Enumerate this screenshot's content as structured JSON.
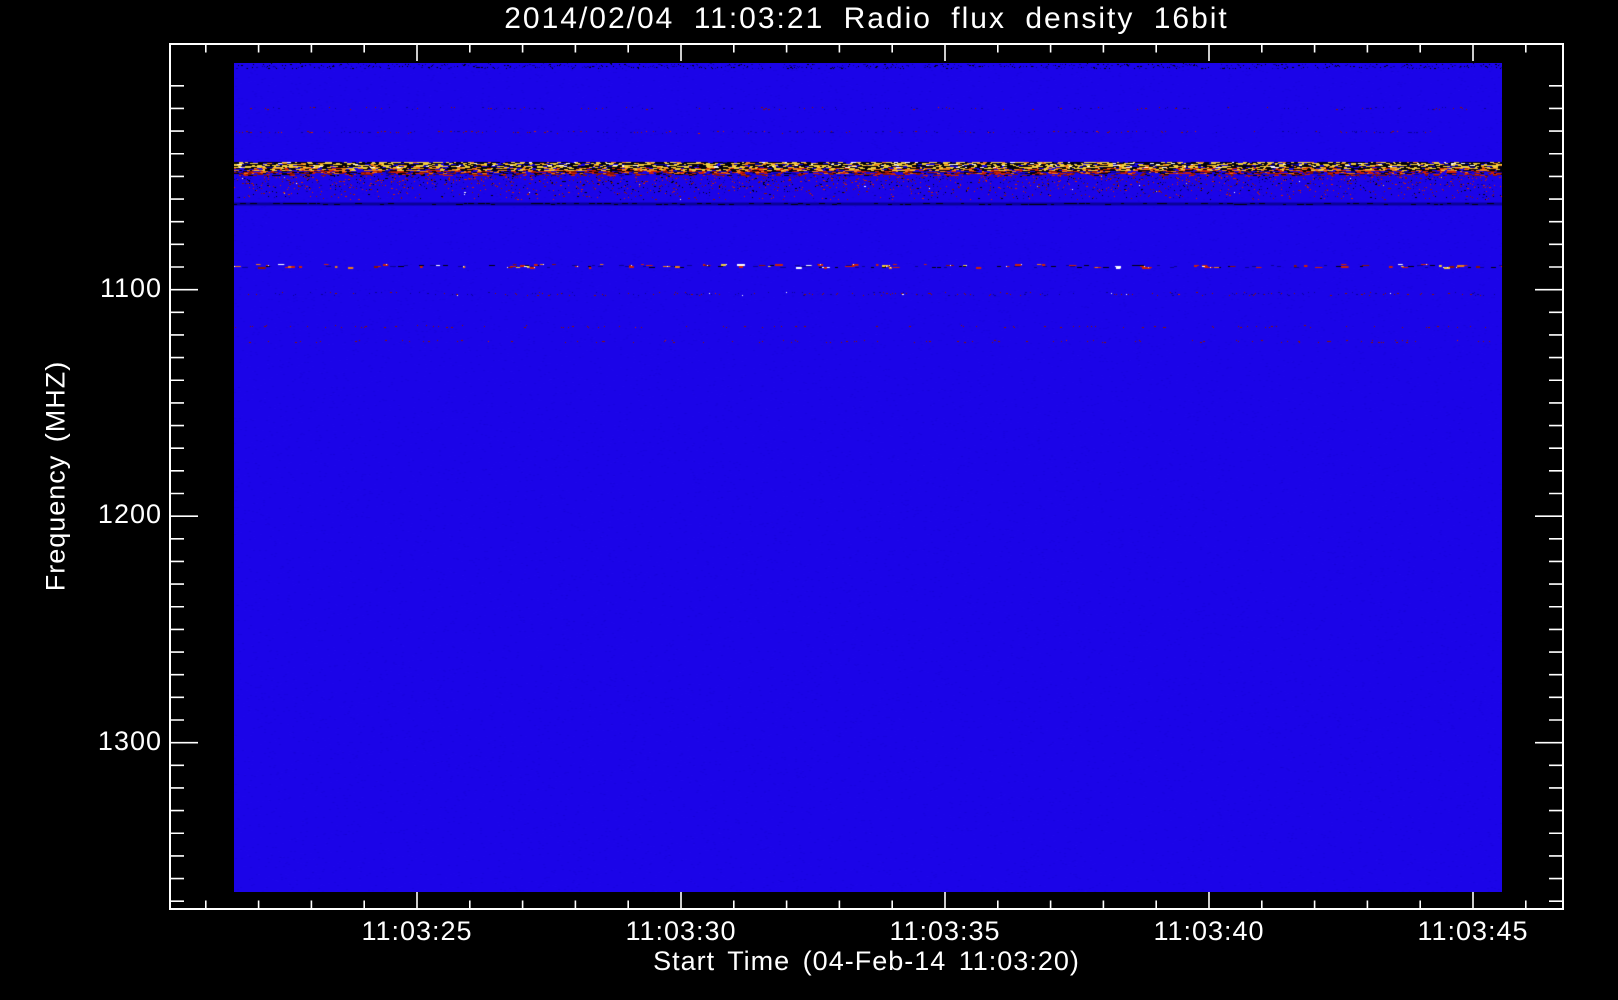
{
  "colors": {
    "page_background": "#000000",
    "frame": "#ffffff",
    "text": "#ffffff"
  },
  "chart_data": {
    "type": "heatmap",
    "title": "2014/02/04 11:03:21 Radio flux density 16bit",
    "x_axis": {
      "label": "Start Time (04-Feb-14 11:03:20)",
      "tick_labels": [
        "11:03:25",
        "11:03:30",
        "11:03:35",
        "11:03:40",
        "11:03:45"
      ],
      "minor_tick_interval_s": 1,
      "range": [
        "11:03:20",
        "11:03:47"
      ]
    },
    "y_axis": {
      "label": "Frequency (MHZ)",
      "tick_labels": [
        "1100",
        "1200",
        "1300"
      ],
      "minor_tick_interval_mhz": 10,
      "range_mhz": [
        992,
        1373
      ],
      "direction": "increasing-downward"
    },
    "legend": null,
    "grid": false,
    "image": {
      "description": "Radio spectrogram: uniform low-flux blue background with narrow horizontal RFI/emission bands",
      "time_span": [
        "11:03:21.5",
        "11:03:45.5"
      ],
      "freq_span_mhz": [
        1000,
        1366
      ],
      "palette": {
        "background": "#1b04e8",
        "noise_dark": "#1002bb",
        "noise_light": "#2d12f8",
        "navy": "#0a0196",
        "black": "#01010a",
        "yellow": "#f1cd3e",
        "orange": "#ec7d18",
        "red": "#cf2206",
        "dark_red": "#8a1404",
        "white": "#ffffff"
      },
      "bands": [
        {
          "name": "top-edge-texture",
          "type": "dots",
          "freq_mhz": 1001.5,
          "thickness": 5,
          "density": 0.5,
          "colors": [
            "navy",
            "black"
          ],
          "bright_prob": 0,
          "bright_colors": []
        },
        {
          "name": "faint-line-1020",
          "type": "dots",
          "freq_mhz": 1020.0,
          "thickness": 2,
          "density": 0.12,
          "colors": [
            "navy",
            "dark_red"
          ],
          "bright_prob": 0.02,
          "bright_colors": [
            "red"
          ]
        },
        {
          "name": "faint-line-1031",
          "type": "dots",
          "freq_mhz": 1030.5,
          "thickness": 2,
          "density": 0.16,
          "colors": [
            "dark_red",
            "navy"
          ],
          "bright_prob": 0.05,
          "bright_colors": [
            "red"
          ]
        },
        {
          "name": "strong-rfi-band",
          "type": "mottle",
          "freq_top_mhz": 1043.5,
          "freq_bottom_mhz": 1050.0,
          "description": "dense black/yellow/orange saturated interference band"
        },
        {
          "name": "speckle-zone",
          "type": "scatter",
          "freq_top_mhz": 1050.0,
          "freq_bottom_mhz": 1060.5,
          "density": 0.1,
          "description": "red/dark speckle noise fading downward"
        },
        {
          "name": "dark-line-1062",
          "type": "dark_line",
          "freq_mhz": 1062.0,
          "thickness": 3
        },
        {
          "name": "activity-line-1090",
          "type": "clusters",
          "freq_mhz": 1089.8,
          "thickness": 7,
          "cluster_count": 110,
          "description": "intermittent red/orange/white bursts"
        },
        {
          "name": "faint-line-1102",
          "type": "dots",
          "freq_mhz": 1102.0,
          "thickness": 3,
          "density": 0.2,
          "colors": [
            "dark_red",
            "navy"
          ],
          "bright_prob": 0.04,
          "bright_colors": [
            "red",
            "white"
          ]
        },
        {
          "name": "faint-line-1117",
          "type": "dots",
          "freq_mhz": 1116.5,
          "thickness": 2,
          "density": 0.07,
          "colors": [
            "dark_red"
          ],
          "bright_prob": 0.02,
          "bright_colors": [
            "red"
          ]
        },
        {
          "name": "faint-line-1123",
          "type": "dots",
          "freq_mhz": 1123.0,
          "thickness": 2,
          "density": 0.07,
          "colors": [
            "dark_red"
          ],
          "bright_prob": 0.02,
          "bright_colors": [
            "red"
          ]
        }
      ]
    }
  }
}
